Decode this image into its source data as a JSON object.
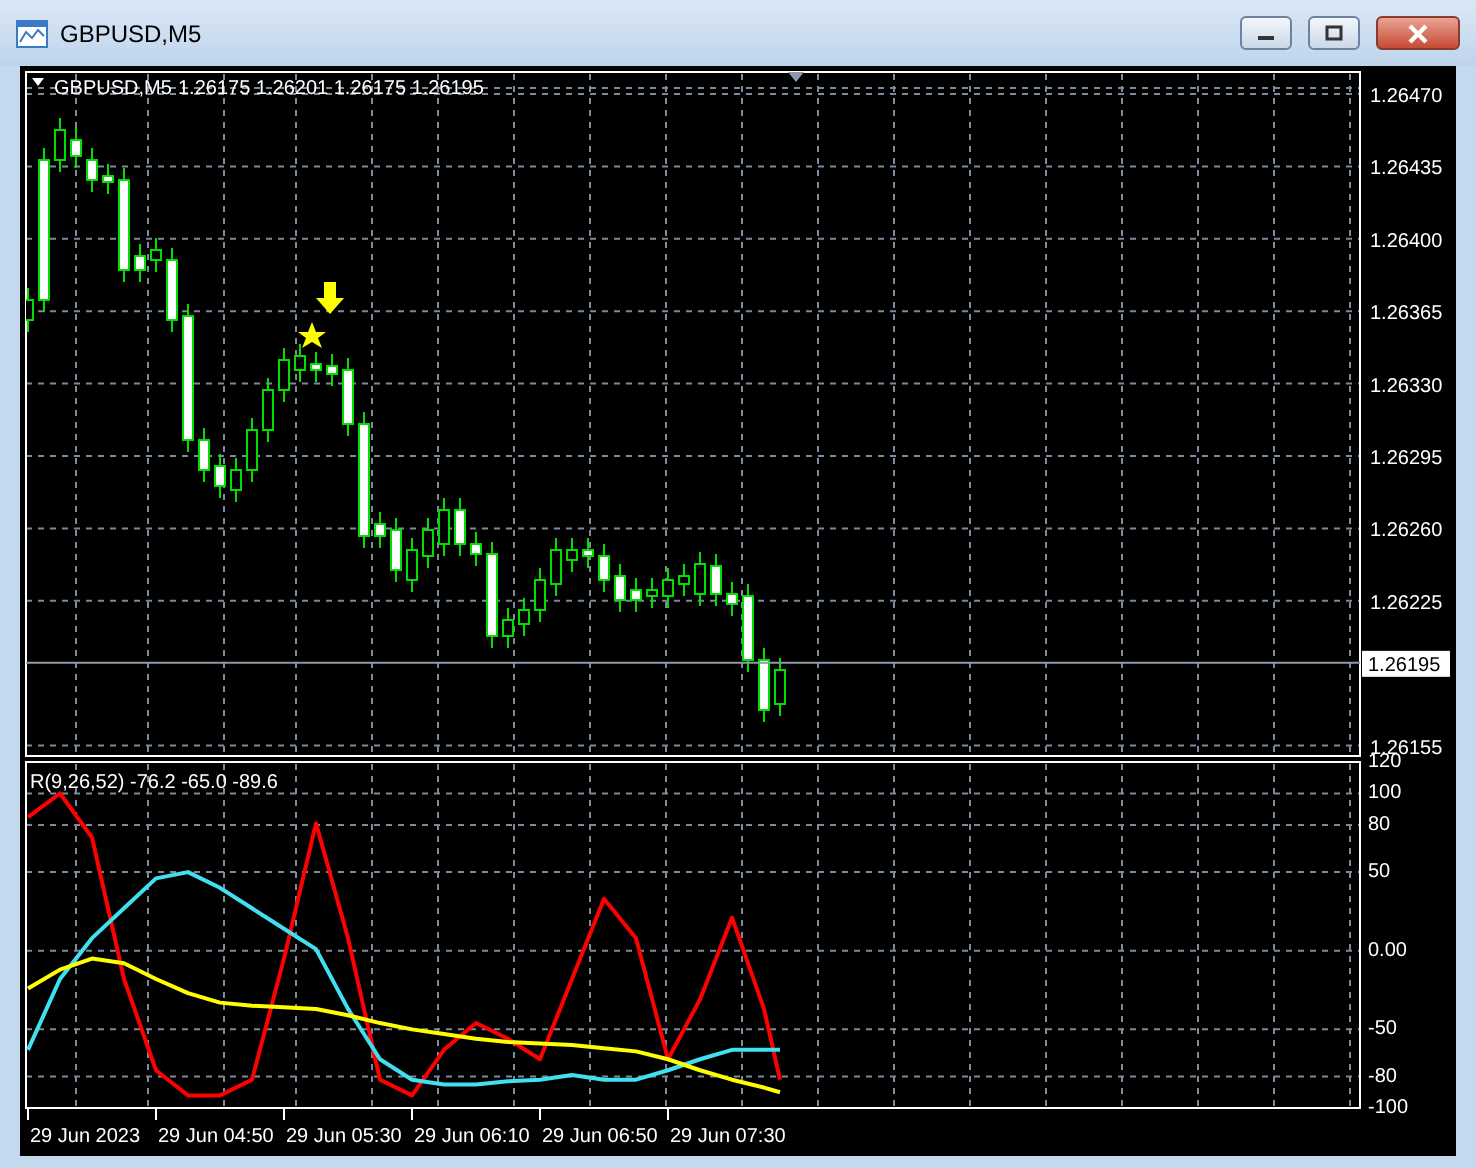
{
  "window": {
    "title": "GBPUSD,M5"
  },
  "chart": {
    "symbol": "GBPUSD,M5",
    "ohlc": "1.26175 1.26201 1.26175 1.26195",
    "price_labels": [
      "1.26470",
      "1.26435",
      "1.26400",
      "1.26365",
      "1.26330",
      "1.26295",
      "1.26260",
      "1.26225",
      "1.26155"
    ],
    "current_price": "1.26195"
  },
  "indicator": {
    "title": "R(9,26,52) -76.2 -65.0 -89.6",
    "scale_labels": [
      "120",
      "100",
      "80",
      "50",
      "0.00",
      "-50",
      "-80",
      "-100"
    ],
    "time_labels": [
      "29 Jun 2023",
      "29 Jun 04:50",
      "29 Jun 05:30",
      "29 Jun 06:10",
      "29 Jun 06:50",
      "29 Jun 07:30"
    ]
  }
}
